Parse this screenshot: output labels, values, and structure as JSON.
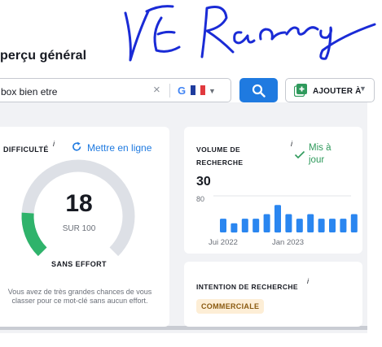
{
  "header": {
    "title": "perçu général"
  },
  "search": {
    "query": "box bien etre",
    "clear_icon": "×",
    "engine_icon": "G",
    "flag_colors": [
      "#1f3c9e",
      "#ffffff",
      "#e0393e"
    ]
  },
  "toolbar": {
    "add_label": "AJOUTER À"
  },
  "difficulty": {
    "label": "DIFFICULTÉ",
    "info": "i",
    "refresh_label": "Mettre en ligne",
    "score": "18",
    "score_fraction": 0.18,
    "out_of": "SUR 100",
    "level": "SANS EFFORT",
    "description": "Vous avez de très grandes chances de vous classer pour ce mot-clé sans aucun effort.",
    "gauge_color": "#2fb36b",
    "track_color": "#dde0e6"
  },
  "volume": {
    "label_line1": "VOLUME DE",
    "label_line2": "RECHERCHE",
    "info": "i",
    "status_line1": "Mis à",
    "status_line2": "jour",
    "value": "30",
    "bar_color": "#2a86f0"
  },
  "chart_data": {
    "type": "bar",
    "yticks": [
      "80"
    ],
    "ylim": [
      0,
      80
    ],
    "xticks": [
      "Jui 2022",
      "Jan 2023"
    ],
    "values": [
      30,
      20,
      30,
      30,
      40,
      60,
      40,
      30,
      40,
      30,
      30,
      30,
      40
    ]
  },
  "intent": {
    "label": "INTENTION DE RECHERCHE",
    "info": "i",
    "badge": "COMMERCIALE"
  }
}
